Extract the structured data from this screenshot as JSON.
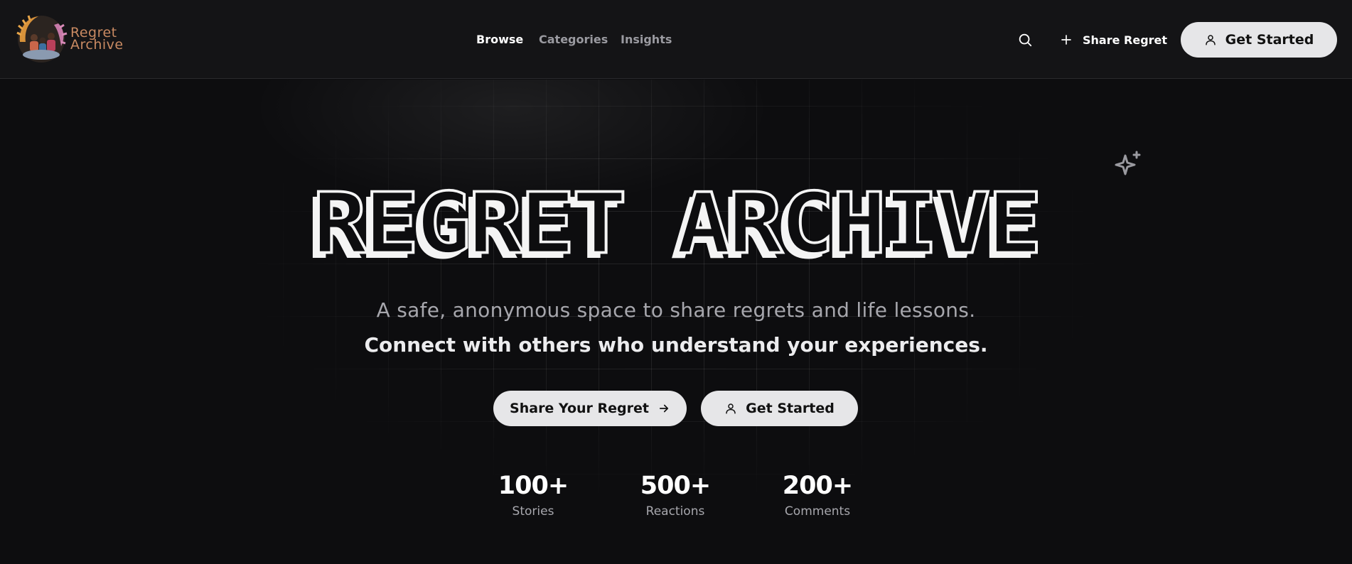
{
  "header": {
    "logo_text_line1": "Regret",
    "logo_text_line2": "Archive",
    "nav": [
      {
        "label": "Browse",
        "active": true
      },
      {
        "label": "Categories",
        "active": false
      },
      {
        "label": "Insights",
        "active": false
      }
    ],
    "share_label": "Share Regret",
    "get_started_label": "Get Started",
    "icons": {
      "search": "search-icon",
      "plus": "plus-icon",
      "user": "user-icon"
    }
  },
  "hero": {
    "title": "REGRET ARCHIVE",
    "subtitle": "A safe, anonymous space to share regrets and life lessons.",
    "subtitle_bold": "Connect with others who understand your experiences.",
    "share_button_label": "Share Your Regret",
    "get_started_label": "Get Started",
    "sparkle_icon": "sparkle-icon"
  },
  "stats": [
    {
      "value": "100+",
      "label": "Stories"
    },
    {
      "value": "500+",
      "label": "Reactions"
    },
    {
      "value": "200+",
      "label": "Comments"
    }
  ],
  "colors": {
    "background": "#0d0d0f",
    "header_bg": "#141416",
    "button_bg": "#e6e6e8",
    "logo_text": "#c98a62",
    "muted_text": "#a7a7ad"
  }
}
